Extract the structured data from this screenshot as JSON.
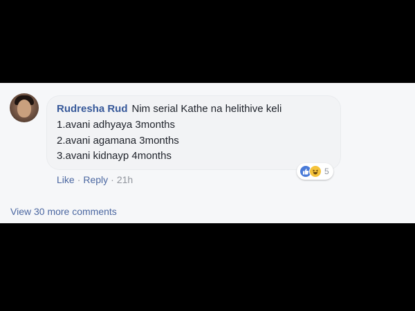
{
  "comment": {
    "author": "Rudresha Rud",
    "text_line1": "Nim serial Kathe na helithive keli",
    "text_line2": "1.avani adhyaya 3months",
    "text_line3": "2.avani agamana 3months",
    "text_line4": "3.avani kidnayp 4months",
    "reaction_count": "5",
    "actions": {
      "like": "Like",
      "reply": "Reply",
      "time": "21h"
    }
  },
  "view_more": "View 30 more comments",
  "colors": {
    "author": "#365899",
    "link": "#4b67a1",
    "meta": "#90949c",
    "panel_bg": "#f6f7f9",
    "bubble_bg": "#f2f3f5",
    "like_blue": "#4a7bd8",
    "haha_yellow": "#f5c33b"
  },
  "icons": [
    "like-reaction-icon",
    "haha-reaction-icon"
  ]
}
